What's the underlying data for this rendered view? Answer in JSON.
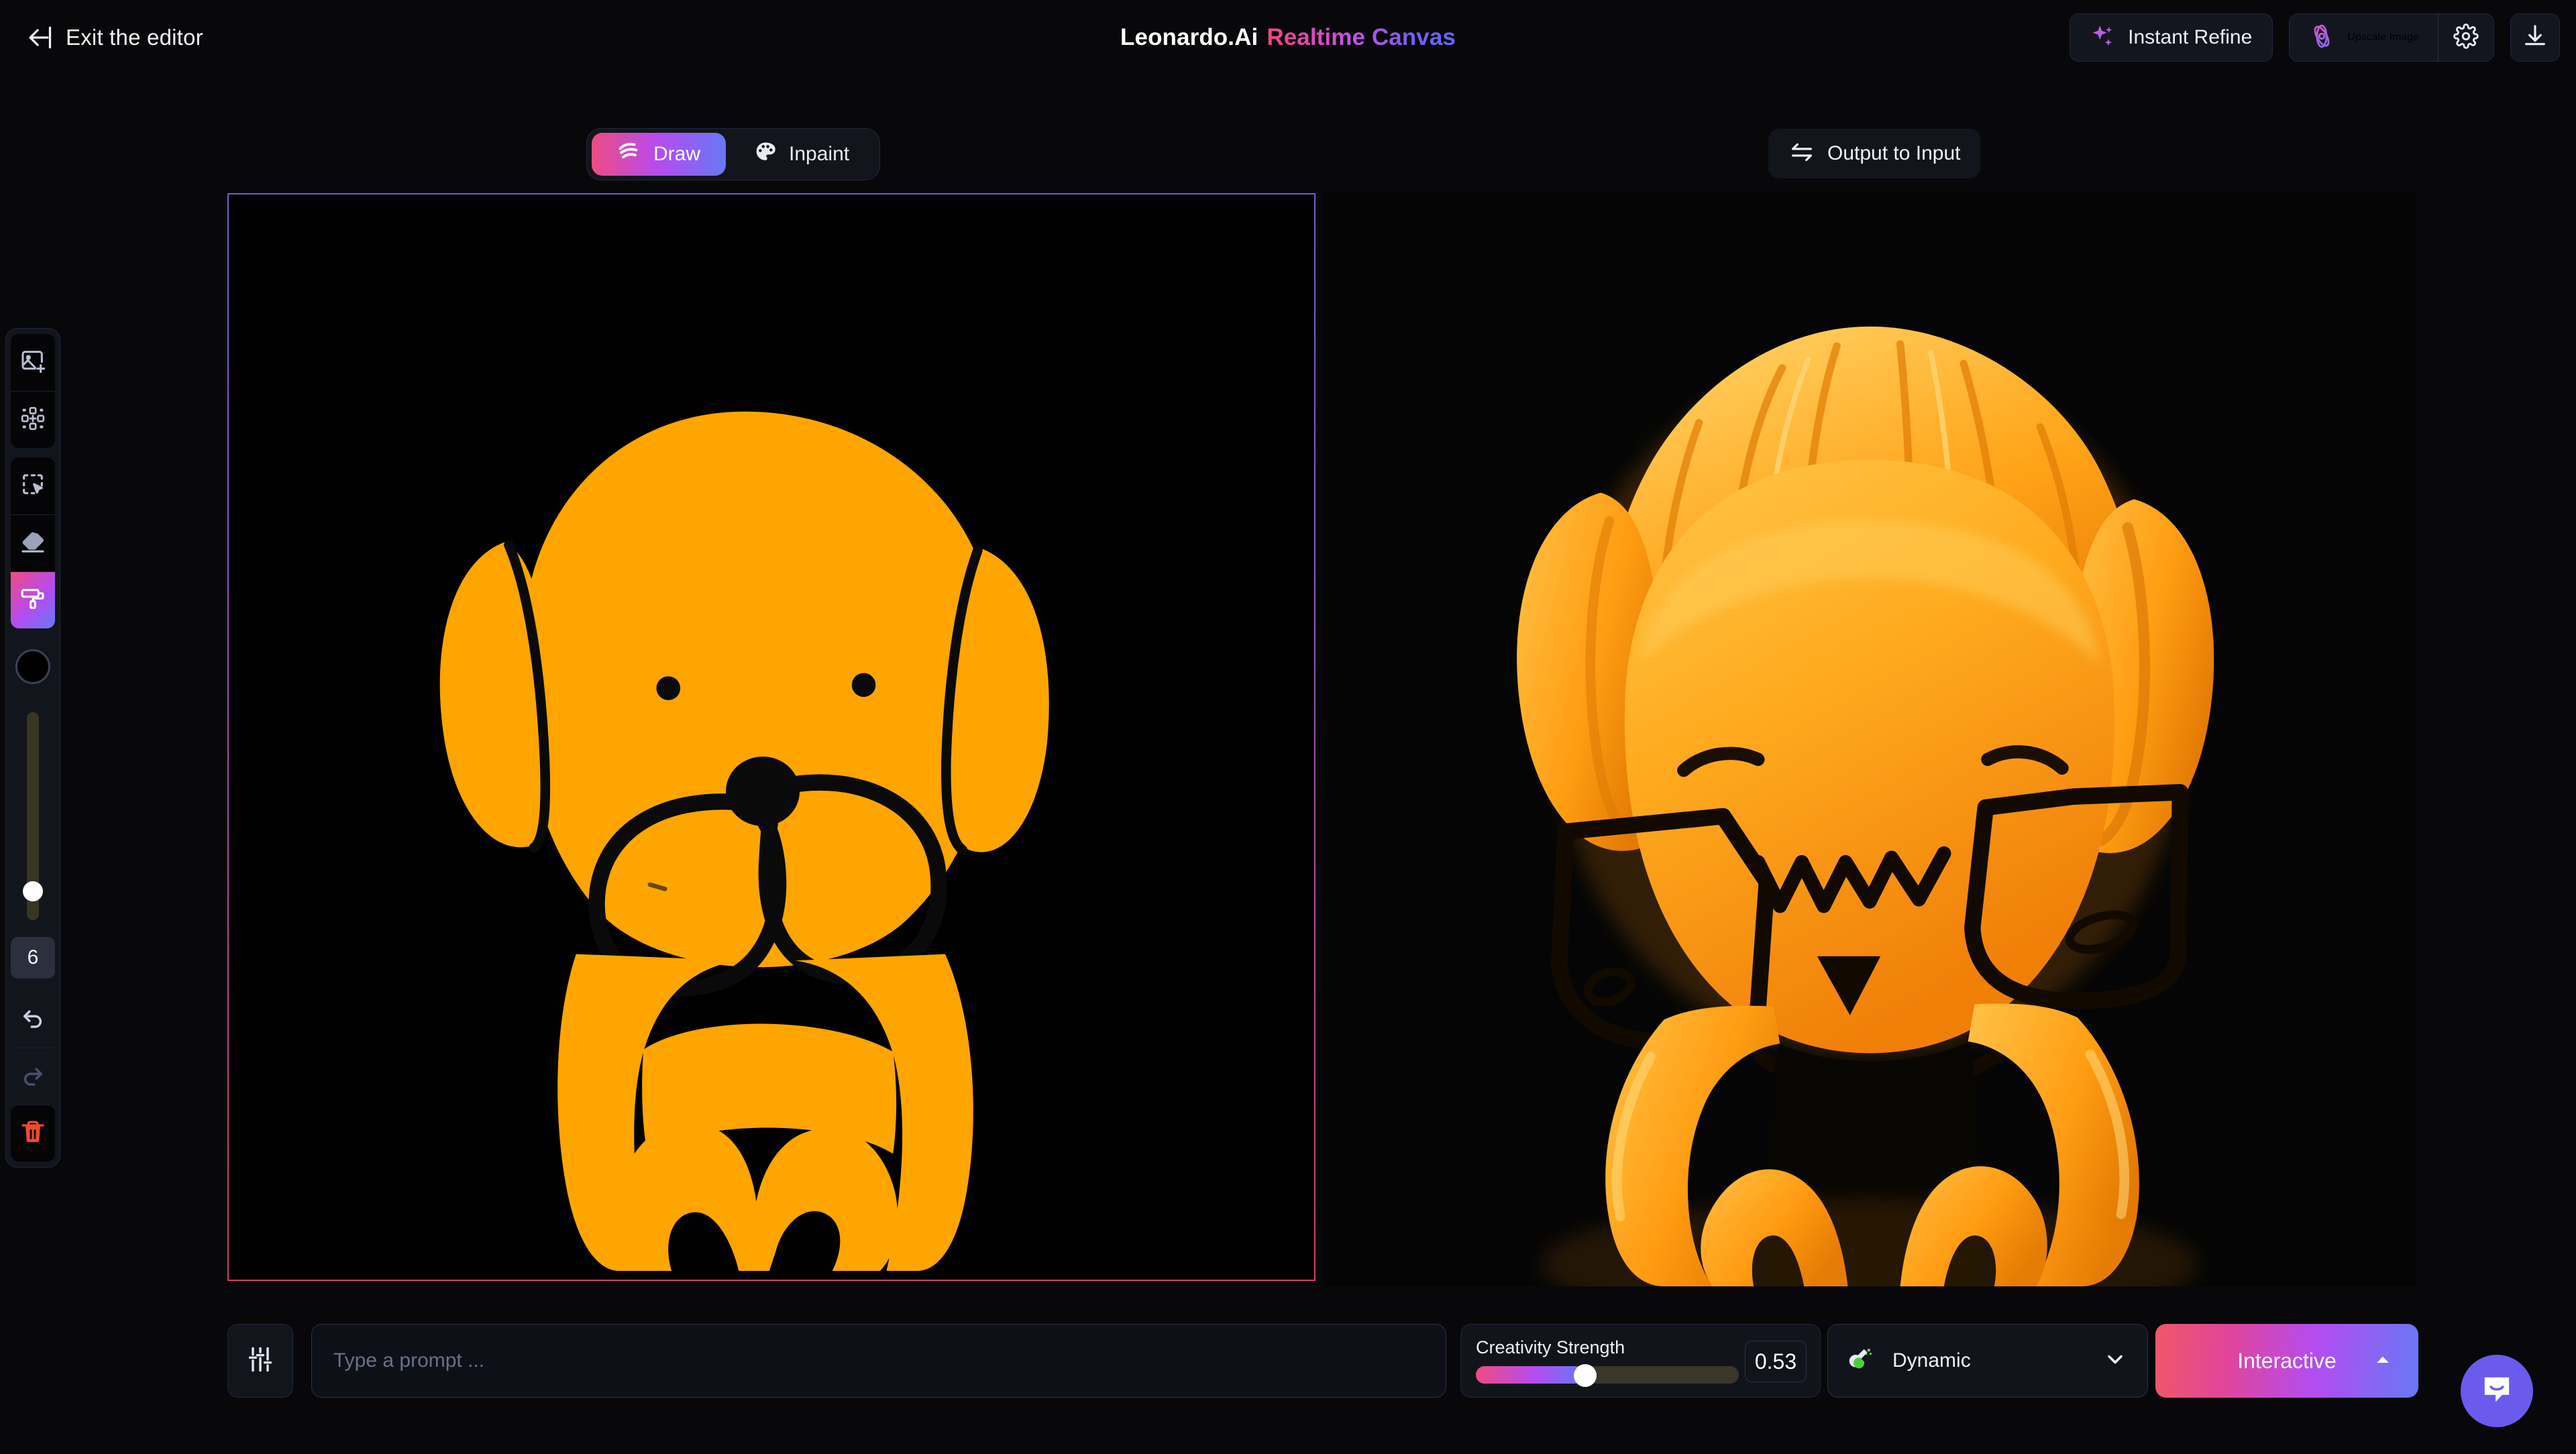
{
  "topbar": {
    "exit_label": "Exit the editor",
    "exit_icon": "arrow-left-to-line-icon",
    "title_brand": "Leonardo.Ai",
    "title_accent": "Realtime Canvas",
    "instant_refine_label": "Instant Refine",
    "instant_refine_icon": "sparkles-icon",
    "upscale_label": "Upscale Image",
    "upscale_icon": "atom-icon",
    "settings_icon": "gear-icon",
    "download_icon": "download-icon"
  },
  "tabs": [
    {
      "label": "Draw",
      "icon": "scribble-icon",
      "active": true
    },
    {
      "label": "Inpaint",
      "icon": "palette-icon",
      "active": false
    }
  ],
  "output_to_input": {
    "label": "Output to Input",
    "icon": "swap-arrows-icon"
  },
  "toolbar": {
    "tools": [
      {
        "name": "add-image",
        "icon": "image-plus-icon",
        "active": false
      },
      {
        "name": "resize-canvas",
        "icon": "expand-canvas-icon",
        "active": false
      },
      {
        "name": "select",
        "icon": "select-cursor-icon",
        "active": false
      },
      {
        "name": "eraser",
        "icon": "eraser-icon",
        "active": false
      },
      {
        "name": "brush",
        "icon": "paint-roller-icon",
        "active": true
      }
    ],
    "color_value": "#000000",
    "brush_size": "6",
    "undo_icon": "undo-icon",
    "redo_icon": "redo-icon",
    "delete_icon": "trash-icon",
    "undo_enabled": true,
    "redo_enabled": false
  },
  "canvas": {
    "input_label": "input-drawing-canvas",
    "output_label": "output-generated-image",
    "drawing_color": "#FFA500",
    "background_color": "#000000",
    "border_gradient": "#6e60c8 to #cf3f5e"
  },
  "bottom": {
    "settings_icon": "sliders-icon",
    "prompt_value": "",
    "prompt_placeholder": "Type a prompt ...",
    "creativity_label": "Creativity Strength",
    "creativity_value": "0.53",
    "preset_label": "Dynamic",
    "preset_icon": "flask-icon",
    "preset_caret": "chevron-down-icon",
    "generate_label": "Interactive",
    "generate_caret": "chevron-up-icon"
  },
  "help": {
    "icon": "chat-bubble-icon"
  }
}
